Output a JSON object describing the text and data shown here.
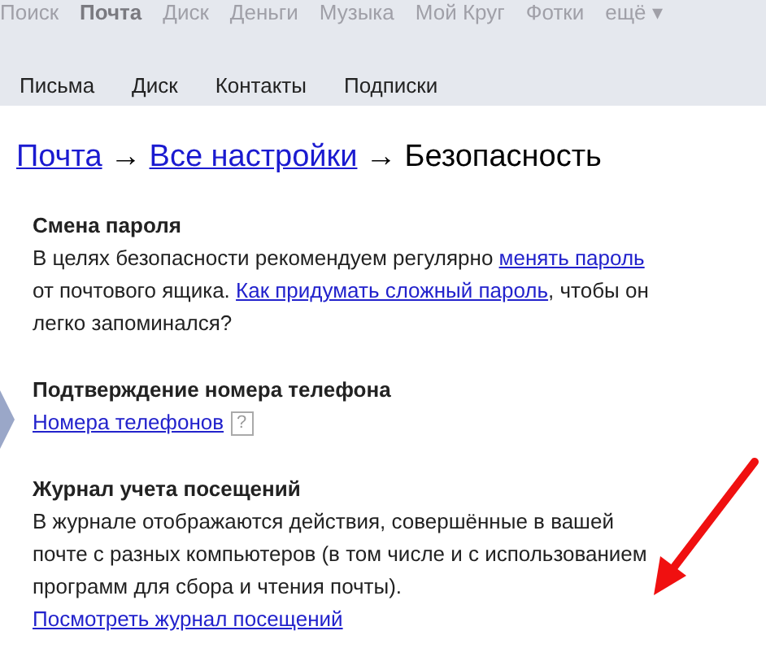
{
  "top_nav": [
    {
      "label": "Поиск",
      "selected": false
    },
    {
      "label": "Почта",
      "selected": true
    },
    {
      "label": "Диск",
      "selected": false
    },
    {
      "label": "Деньги",
      "selected": false
    },
    {
      "label": "Музыка",
      "selected": false
    },
    {
      "label": "Мой Круг",
      "selected": false
    },
    {
      "label": "Фотки",
      "selected": false
    },
    {
      "label": "ещё ▾",
      "selected": false
    }
  ],
  "sub_nav": [
    "Письма",
    "Диск",
    "Контакты",
    "Подписки"
  ],
  "breadcrumb": {
    "links": [
      "Почта",
      "Все настройки"
    ],
    "separator": "→",
    "current": "Безопасность"
  },
  "sections": [
    {
      "title": "Смена пароля",
      "body": [
        {
          "kind": "text",
          "text": "В целях безопасности рекомендуем регулярно "
        },
        {
          "kind": "link",
          "text": "менять пароль"
        },
        {
          "kind": "text",
          "text": " от почтового ящика. "
        },
        {
          "kind": "link",
          "text": "Как придумать сложный пароль"
        },
        {
          "kind": "text",
          "text": ", чтобы он легко запоминался?"
        }
      ]
    },
    {
      "title": "Подтверждение номера телефона",
      "body": [
        {
          "kind": "link",
          "text": "Номера телефонов"
        },
        {
          "kind": "help",
          "text": "?"
        }
      ]
    },
    {
      "title": "Журнал учета посещений",
      "body": [
        {
          "kind": "text",
          "text": "В журнале отображаются действия, совершённые в вашей почте с разных компьютеров (в том числе и с использованием программ для сбора и чтения почты). "
        },
        {
          "kind": "link",
          "text": "Посмотреть журнал посещений"
        }
      ]
    }
  ]
}
